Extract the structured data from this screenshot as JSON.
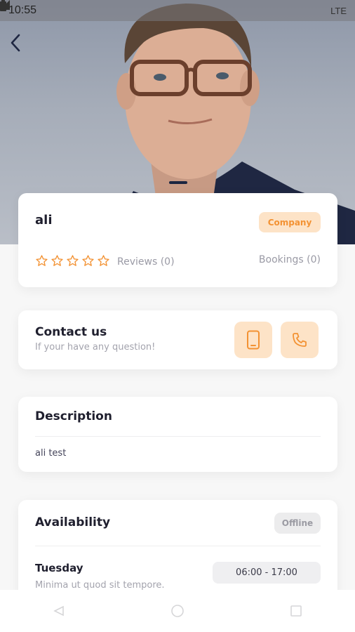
{
  "status_bar": {
    "time": "10:55",
    "network": "LTE"
  },
  "hero": {
    "pager_active_index": 0
  },
  "profile": {
    "name": "ali",
    "badge": "Company",
    "rating": 0,
    "reviews_label": "Reviews (0)",
    "bookings_label": "Bookings (0)"
  },
  "contact": {
    "title": "Contact us",
    "subtitle": "If your have any question!"
  },
  "description": {
    "title": "Description",
    "text": "ali test"
  },
  "availability": {
    "title": "Availability",
    "status": "Offline",
    "days": [
      {
        "day": "Tuesday",
        "note": "Minima ut quod sit tempore.",
        "hours": "06:00 - 17:00"
      }
    ]
  },
  "colors": {
    "accent": "#f39233",
    "accent_soft": "#fde3c7",
    "text_dark": "#1f1f2e",
    "text_muted": "#a3a3ad"
  },
  "icons": {
    "back": "back-arrow-icon",
    "mobile": "mobile-phone-icon",
    "call": "phone-call-icon",
    "star": "star-outline-icon"
  }
}
